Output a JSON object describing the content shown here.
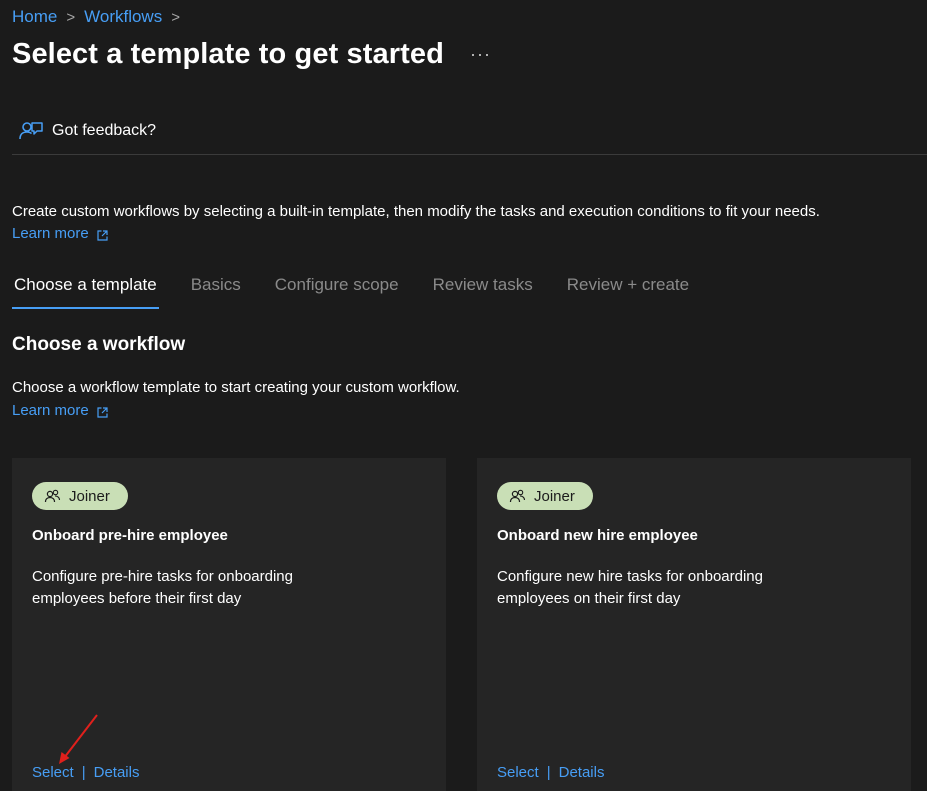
{
  "breadcrumb": {
    "items": [
      {
        "label": "Home"
      },
      {
        "label": "Workflows"
      }
    ],
    "separator": ">"
  },
  "page": {
    "title": "Select a template to get started",
    "more_label": "···"
  },
  "feedback": {
    "label": "Got feedback?",
    "icon": "feedback-person-icon"
  },
  "intro": {
    "text": "Create custom workflows by selecting a built-in template, then modify the tasks and execution conditions to fit your needs.",
    "learn_more": "Learn more"
  },
  "tabs": [
    {
      "label": "Choose a template",
      "active": true
    },
    {
      "label": "Basics",
      "active": false
    },
    {
      "label": "Configure scope",
      "active": false
    },
    {
      "label": "Review tasks",
      "active": false
    },
    {
      "label": "Review + create",
      "active": false
    }
  ],
  "section": {
    "title": "Choose a workflow",
    "description": "Choose a workflow template to start creating your custom workflow.",
    "learn_more": "Learn more"
  },
  "cards": [
    {
      "badge": "Joiner",
      "title": "Onboard pre-hire employee",
      "description": "Configure pre-hire tasks for onboarding employees before their first day",
      "select_label": "Select",
      "details_label": "Details"
    },
    {
      "badge": "Joiner",
      "title": "Onboard new hire employee",
      "description": "Configure new hire tasks for onboarding employees on their first day",
      "select_label": "Select",
      "details_label": "Details"
    }
  ],
  "colors": {
    "background": "#1b1b1b",
    "card_background": "#252525",
    "link": "#479ef5",
    "badge": "#c9dfb6",
    "annotation_arrow": "#e0201c"
  }
}
